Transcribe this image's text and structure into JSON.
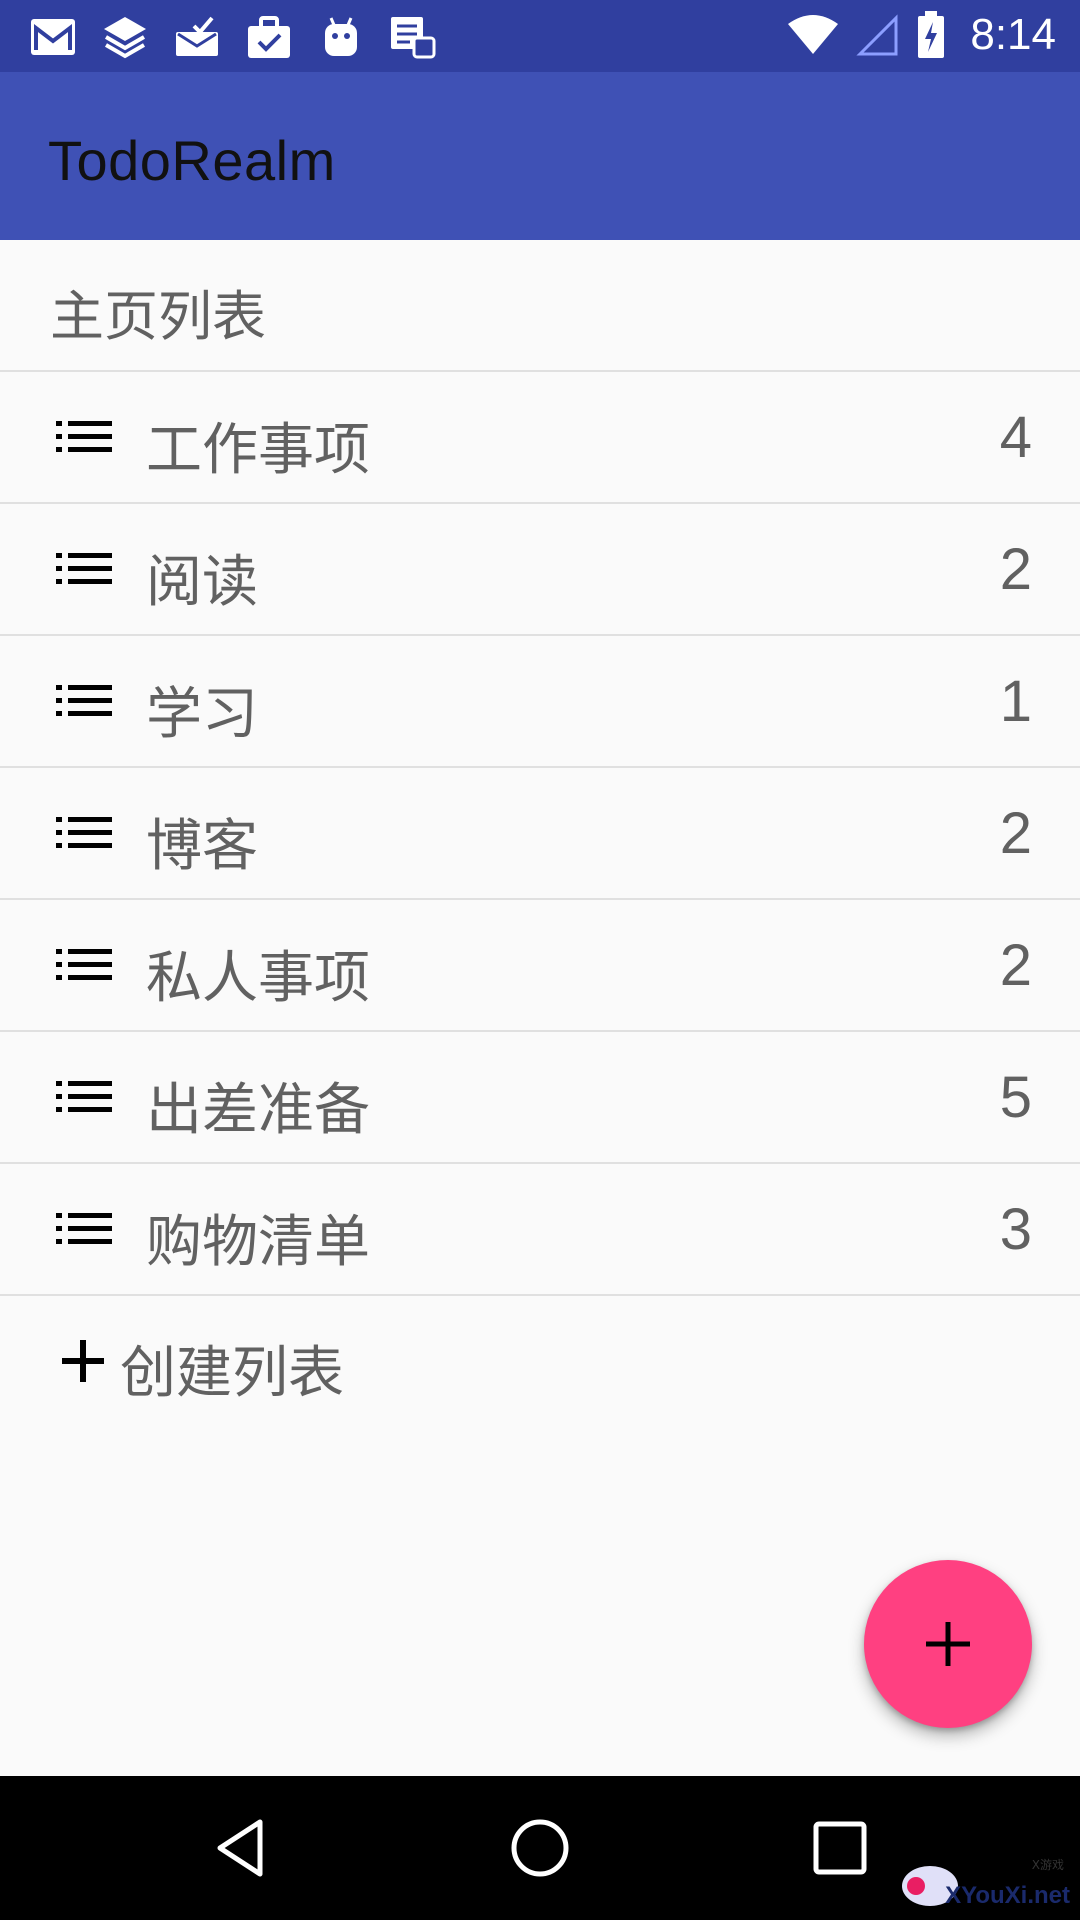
{
  "status_bar": {
    "time": "8:14",
    "notification_icons": [
      "gmail-icon",
      "layers-icon",
      "mail-check-icon",
      "briefcase-check-icon",
      "android-icon",
      "tasks-icon"
    ],
    "status_icons": [
      "wifi-icon",
      "signal-icon",
      "battery-charging-icon"
    ]
  },
  "app_bar": {
    "title": "TodoRealm"
  },
  "section": {
    "title": "主页列表"
  },
  "lists": [
    {
      "label": "工作事项",
      "count": "4"
    },
    {
      "label": "阅读",
      "count": "2"
    },
    {
      "label": "学习",
      "count": "1"
    },
    {
      "label": "博客",
      "count": "2"
    },
    {
      "label": "私人事项",
      "count": "2"
    },
    {
      "label": "出差准备",
      "count": "5"
    },
    {
      "label": "购物清单",
      "count": "3"
    }
  ],
  "create": {
    "label": "创建列表"
  },
  "fab": {
    "icon": "plus-icon",
    "color": "#ff4081"
  },
  "nav": {
    "buttons": [
      "back-icon",
      "home-icon",
      "recents-icon"
    ]
  },
  "watermark": {
    "text": "XYouXi.net",
    "small": "X游戏"
  },
  "colors": {
    "status_bar": "#303f9f",
    "app_bar": "#3f51b5",
    "accent": "#ff4081"
  }
}
